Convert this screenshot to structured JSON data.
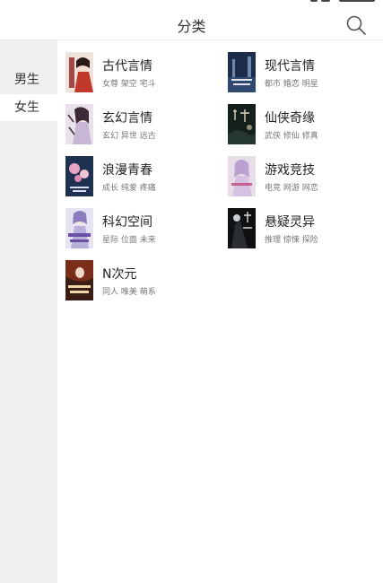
{
  "header": {
    "title": "分类"
  },
  "sidebar": {
    "items": [
      {
        "label": "男生",
        "active": false
      },
      {
        "label": "女生",
        "active": true
      }
    ]
  },
  "categories": [
    {
      "name": "古代言情",
      "tags": "女尊 架空 宅斗",
      "cover": "ancient-romance-cover"
    },
    {
      "name": "现代言情",
      "tags": "都市 婚恋 明星",
      "cover": "modern-romance-cover"
    },
    {
      "name": "玄幻言情",
      "tags": "玄幻 异世 远古",
      "cover": "fantasy-romance-cover"
    },
    {
      "name": "仙侠奇缘",
      "tags": "武侠 修仙 修真",
      "cover": "xianxia-cover"
    },
    {
      "name": "浪漫青春",
      "tags": "成长 纯爱 疼痛",
      "cover": "youth-romance-cover"
    },
    {
      "name": "游戏竞技",
      "tags": "电竞 网游 网恋",
      "cover": "gaming-cover"
    },
    {
      "name": "科幻空间",
      "tags": "星际 位面 未来",
      "cover": "scifi-cover"
    },
    {
      "name": "悬疑灵异",
      "tags": "推理 惊悚 探险",
      "cover": "suspense-cover"
    },
    {
      "name": "N次元",
      "tags": "同人 唯美 萌系",
      "cover": "n-dimension-cover"
    }
  ],
  "colors": {
    "sidebar_bg": "#efefef",
    "active_bg": "#ffffff",
    "divider": "#ececec"
  }
}
